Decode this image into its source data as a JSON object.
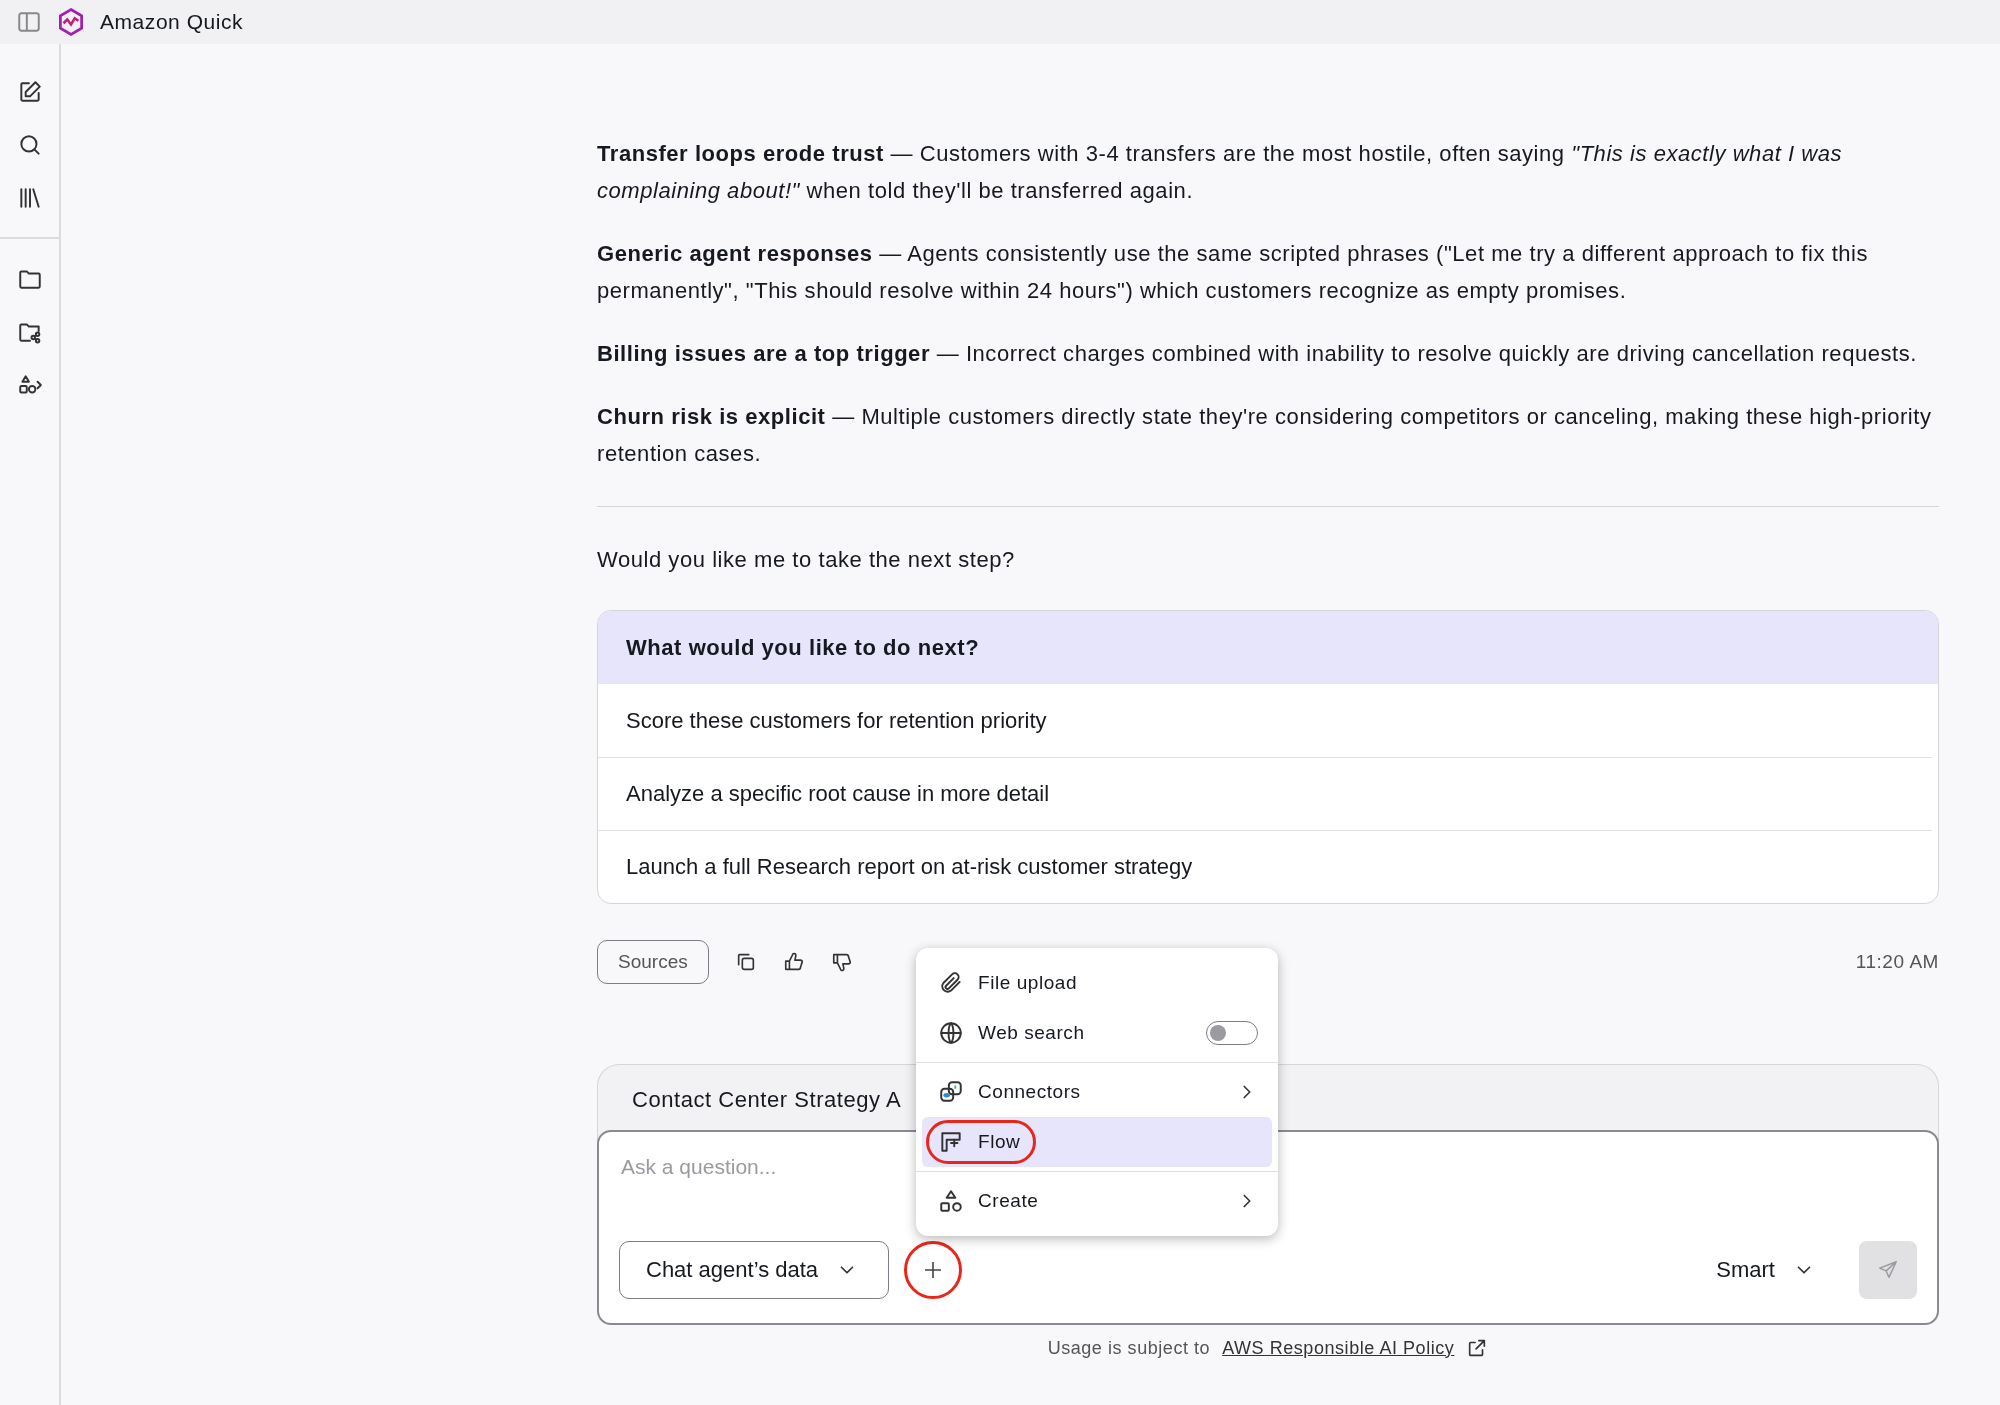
{
  "app": {
    "title": "Amazon Quick"
  },
  "message": {
    "paragraphs": [
      "**Transfer loops erode trust** — Customers with 3-4 transfers are the most hostile, often saying *\"This is exactly what I was complaining about!\"* when told they'll be transferred again.",
      "**Generic agent responses** — Agents consistently use the same scripted phrases (\"Let me try a different approach to fix this permanently\", \"This should resolve within 24 hours\") which customers recognize as empty promises.",
      "**Billing issues are a top trigger** — Incorrect charges combined with inability to resolve quickly are driving cancellation requests.",
      "**Churn risk is explicit** — Multiple customers directly state they're considering competitors or canceling, making these high-priority retention cases."
    ],
    "question": "Would you like me to take the next step?",
    "options": {
      "title": "What would you like to do next?",
      "items": [
        "Score these customers for retention priority",
        "Analyze a specific root cause in more detail",
        "Launch a full Research report on at-risk customer strategy"
      ]
    },
    "actions": {
      "sources": "Sources",
      "time": "11:20 AM"
    }
  },
  "context_tab": "Contact Center Strategy A",
  "composer": {
    "placeholder": "Ask a question...",
    "data_source": "Chat agent’s data",
    "plus_annotated": true,
    "mode": "Smart"
  },
  "menu": {
    "groups": [
      [
        {
          "kind": "action",
          "label": "File upload",
          "selected": false,
          "annotated": false
        },
        {
          "kind": "toggle",
          "label": "Web search",
          "on": false,
          "selected": false,
          "annotated": false
        }
      ],
      [
        {
          "kind": "submenu",
          "label": "Connectors",
          "selected": false,
          "annotated": false
        },
        {
          "kind": "action",
          "label": "Flow",
          "selected": true,
          "annotated": true
        }
      ],
      [
        {
          "kind": "submenu",
          "label": "Create",
          "selected": false,
          "annotated": false
        }
      ]
    ]
  },
  "footer": {
    "text": "Usage is subject to",
    "link": "AWS Responsible AI Policy"
  }
}
